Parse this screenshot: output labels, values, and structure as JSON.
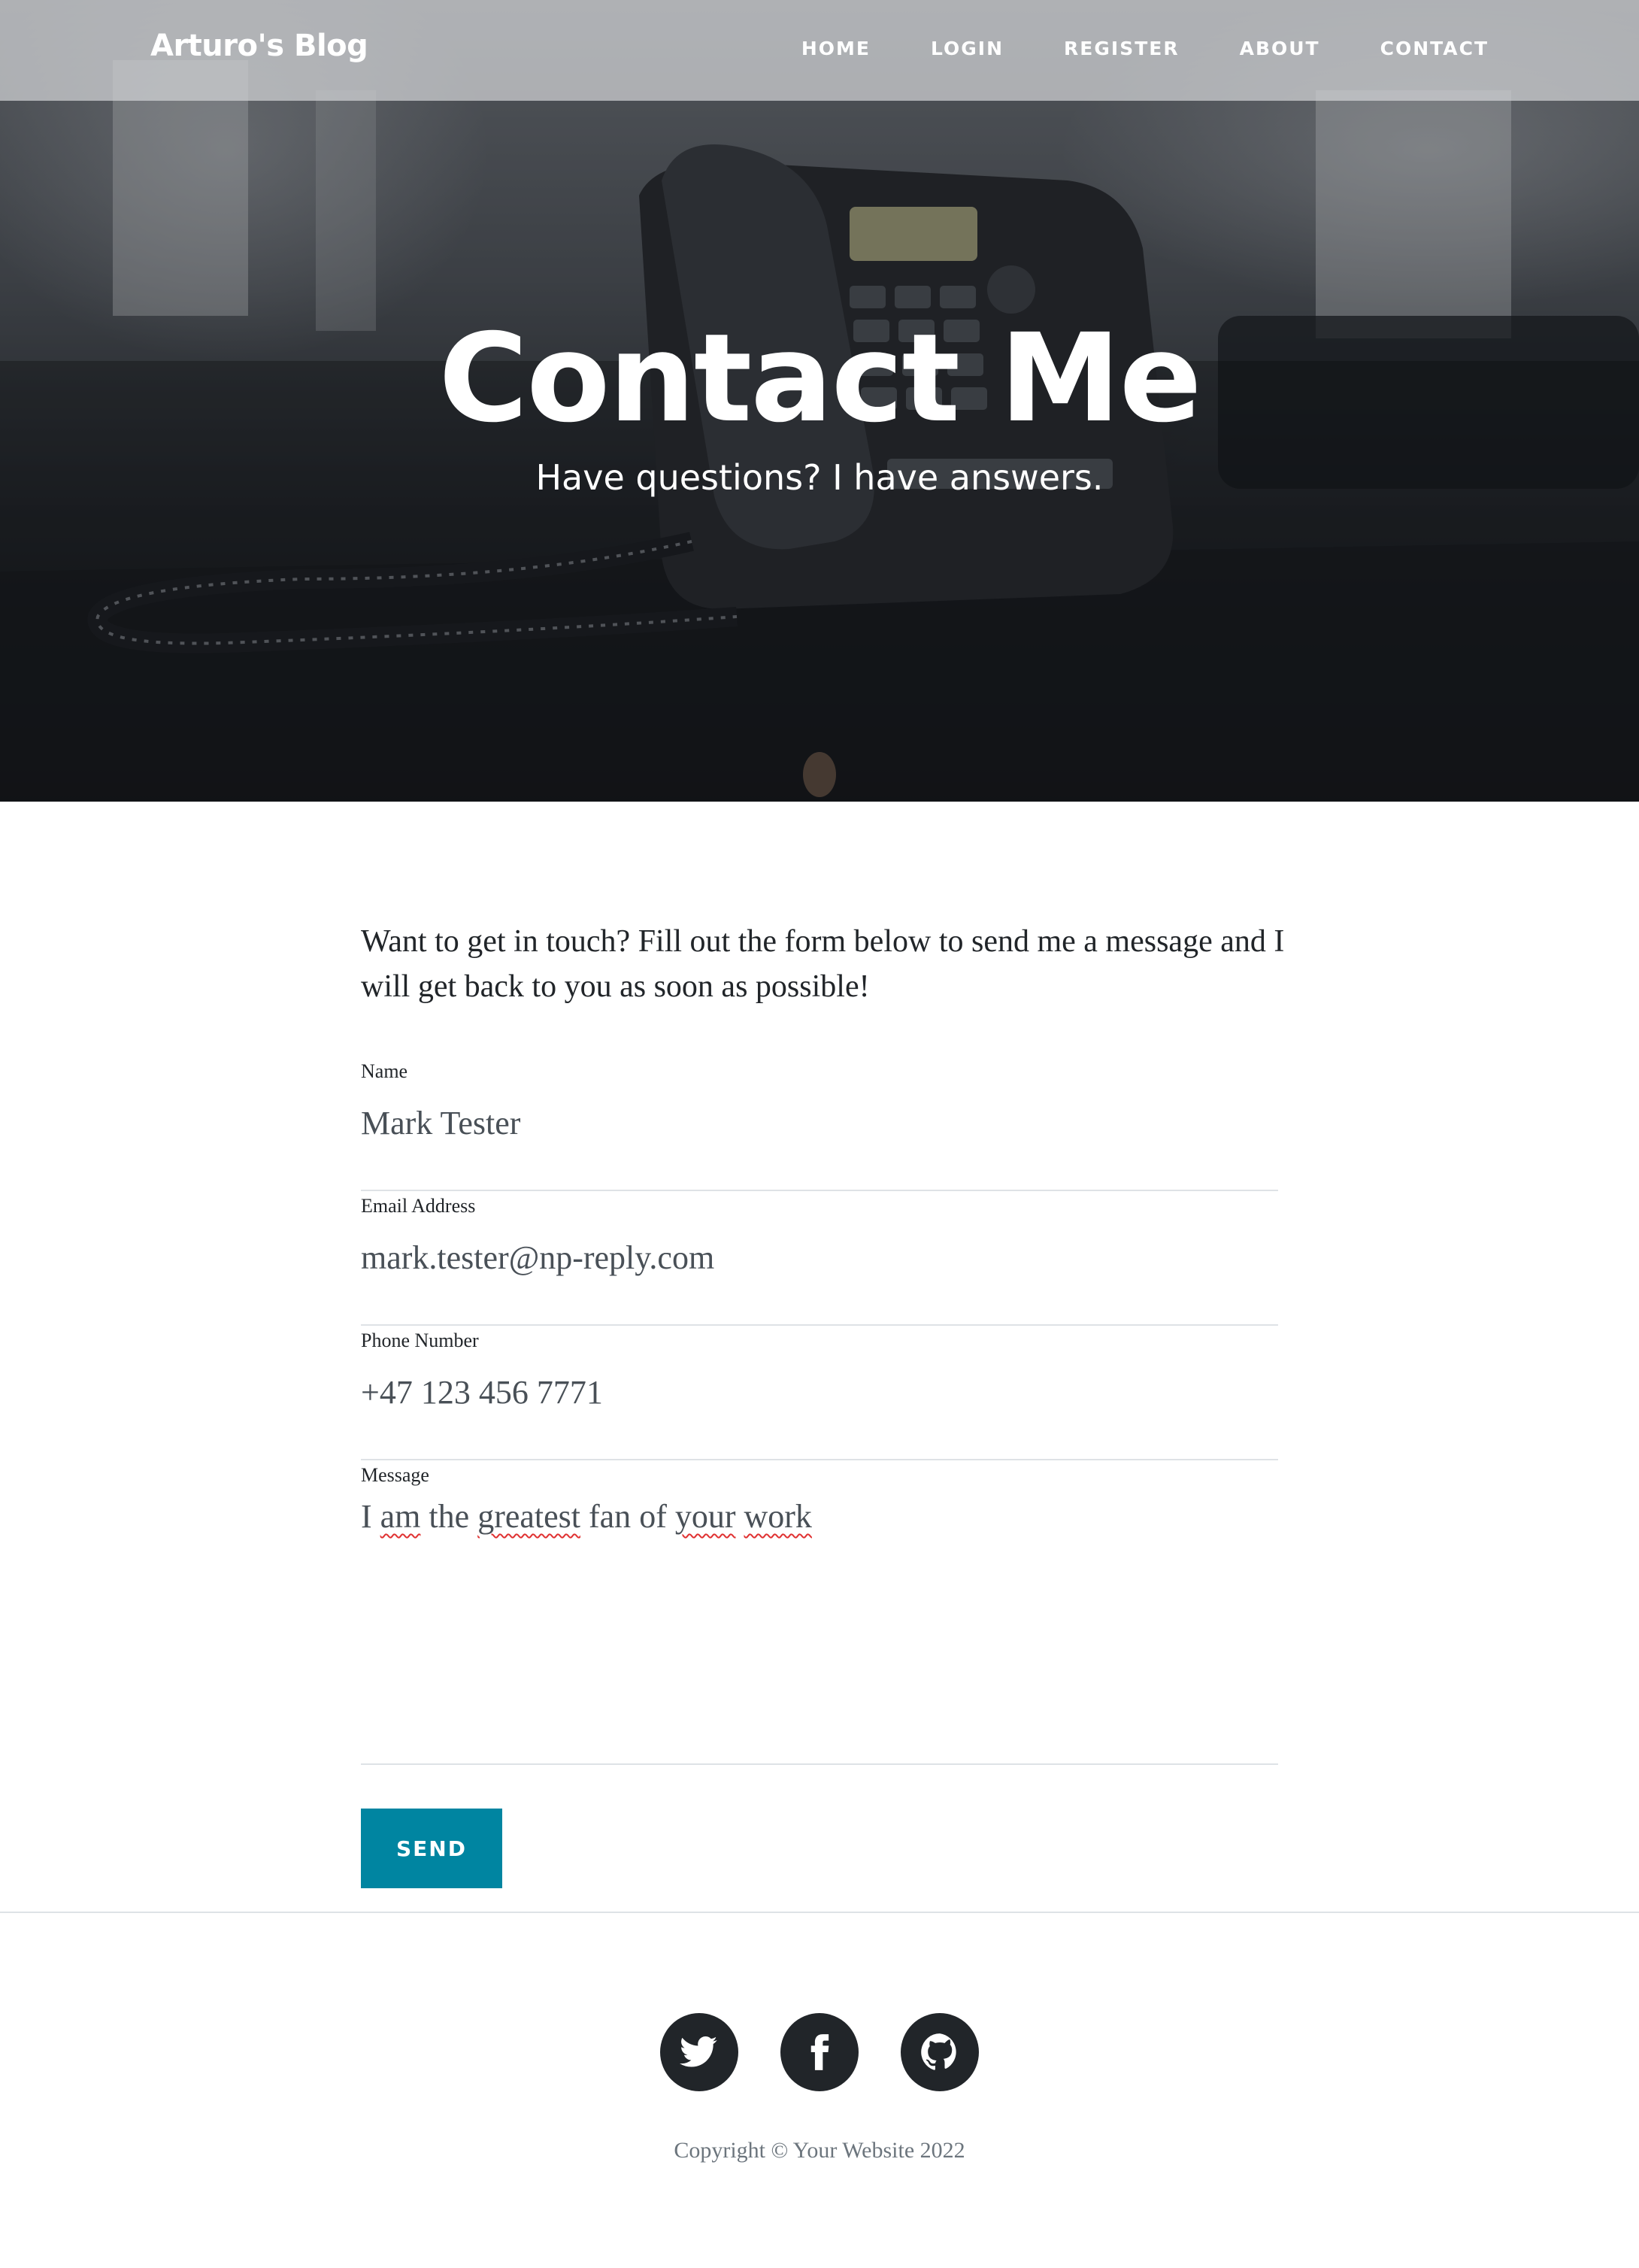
{
  "navbar": {
    "brand": "Arturo's Blog",
    "links": [
      "Home",
      "Login",
      "Register",
      "About",
      "Contact"
    ]
  },
  "hero": {
    "title": "Contact Me",
    "subtitle": "Have questions? I have answers."
  },
  "intro": "Want to get in touch? Fill out the form below to send me a message and I will get back to you as soon as possible!",
  "form": {
    "name": {
      "label": "Name",
      "value": "Mark Tester"
    },
    "email": {
      "label": "Email Address",
      "value": "mark.tester@np-reply.com"
    },
    "phone": {
      "label": "Phone Number",
      "value": "+47 123 456 7771"
    },
    "message": {
      "label": "Message",
      "words": [
        "I",
        "am",
        "the",
        "greatest",
        "fan",
        "of",
        "your",
        "work"
      ]
    },
    "send_label": "Send"
  },
  "footer": {
    "social_icons": [
      "twitter-icon",
      "facebook-icon",
      "github-icon"
    ],
    "copyright": "Copyright © Your Website 2022"
  },
  "colors": {
    "accent": "#0085a1",
    "footer_icon_bg": "#212529",
    "spellcheck": "#e03131"
  }
}
